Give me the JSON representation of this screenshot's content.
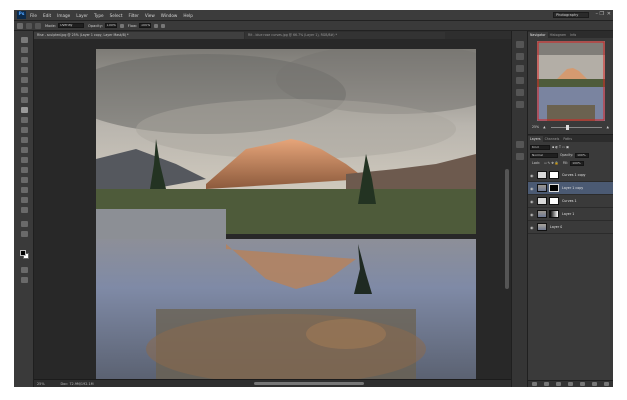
{
  "app": {
    "logo": "Ps"
  },
  "menu": [
    "File",
    "Edit",
    "Image",
    "Layer",
    "Type",
    "Select",
    "Filter",
    "View",
    "Window",
    "Help"
  ],
  "workspace": "Photography",
  "window_controls": {
    "minimize": "–",
    "restore": "❐",
    "close": "✕"
  },
  "options": {
    "mode_label": "Mode:",
    "mode_value": "Overlay",
    "opacity_label": "Opacity:",
    "opacity_value": "100%",
    "flow_label": "Flow:",
    "flow_value": "100%"
  },
  "doc_tabs": [
    {
      "label": "Rise - sculpted.jpg @ 25% (Layer 1 copy, Layer Mask/8) *",
      "active": true
    },
    {
      "label": "Rit - blue rose curves.jpg @ 66.7% (Layer 1), RGB/8#) *",
      "active": false
    }
  ],
  "status": {
    "zoom": "25%",
    "doc": "Doc: 72.9M/192.1M"
  },
  "panel_tabs": {
    "top": [
      "Navigator",
      "Histogram",
      "Info"
    ],
    "layers": [
      "Layers",
      "Channels",
      "Paths"
    ]
  },
  "navigator": {
    "zoom": "25%"
  },
  "layers_controls": {
    "kind_label": "Kind",
    "blend_mode": "Normal",
    "opacity_label": "Opacity:",
    "opacity_value": "100%",
    "lock_label": "Lock:",
    "fill_label": "Fill:",
    "fill_value": "100%"
  },
  "layers": [
    {
      "name": "Curves 1 copy",
      "selected": false,
      "type": "adjustment"
    },
    {
      "name": "Layer 1 copy",
      "selected": true,
      "type": "pixel"
    },
    {
      "name": "Curves 1",
      "selected": false,
      "type": "adjustment"
    },
    {
      "name": "Layer 1",
      "selected": false,
      "type": "pixel"
    },
    {
      "name": "Layer 0",
      "selected": false,
      "type": "pixel"
    }
  ],
  "colors": {
    "accent_selected": "#4b5a73",
    "panel_bg": "#3a3a3a",
    "app_bg": "#282828"
  }
}
